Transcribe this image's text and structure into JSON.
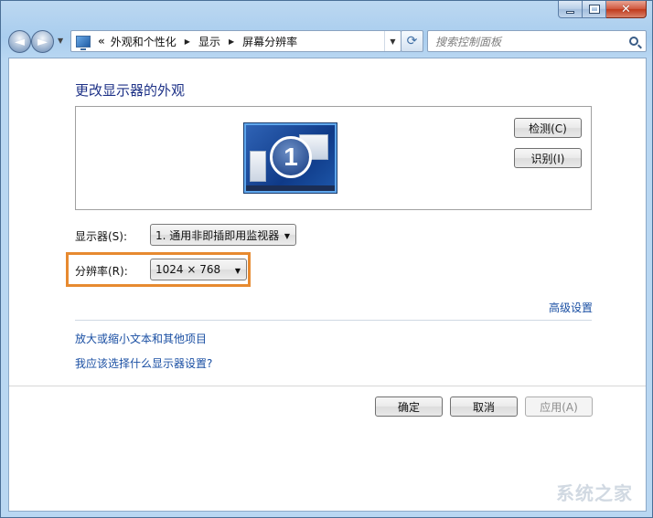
{
  "window": {
    "caption": {
      "minimize": "—",
      "maximize": "",
      "close": "✕"
    }
  },
  "nav": {
    "back_glyph": "◄",
    "forward_glyph": "►",
    "dropdown_glyph": "▼",
    "address": {
      "overflow": "«",
      "crumbs": [
        "外观和个性化",
        "显示",
        "屏幕分辨率"
      ],
      "crumb_arrow": "▶",
      "dropdown_glyph": "▼"
    },
    "refresh_glyph": "⟳",
    "search_placeholder": "搜索控制面板"
  },
  "page": {
    "title": "更改显示器的外观",
    "monitor_number": "1",
    "detect_label": "检测(C)",
    "identify_label": "识别(I)",
    "display_label": "显示器(S):",
    "display_value": "1. 通用非即插即用监视器",
    "resolution_label": "分辨率(R):",
    "resolution_value": "1024 × 768",
    "select_arrow": "▼",
    "advanced_link": "高级设置",
    "enlarge_link": "放大或缩小文本和其他项目",
    "which_link": "我应该选择什么显示器设置?",
    "ok_label": "确定",
    "cancel_label": "取消",
    "apply_label": "应用(A)"
  },
  "watermark": "系统之家",
  "colors": {
    "highlight_border": "#e78a30",
    "link": "#1a4fa3",
    "title": "#1e3287"
  }
}
